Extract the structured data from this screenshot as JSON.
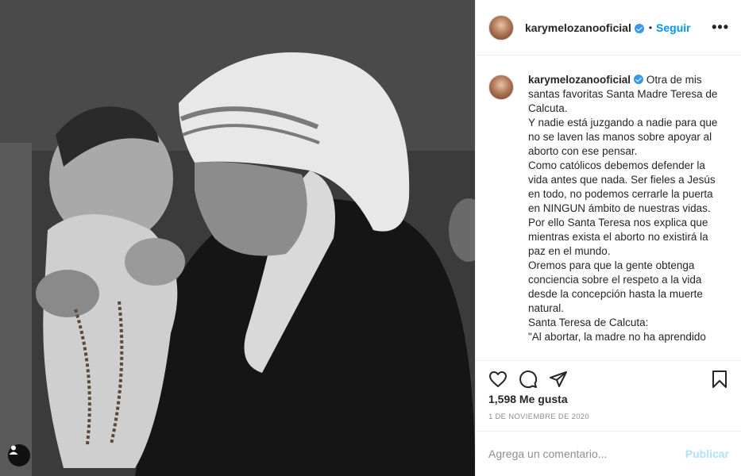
{
  "post": {
    "image_alt": "Santa Madre Teresa de Calcuta con un bebé"
  },
  "header": {
    "username": "karymelozanooficial",
    "separator": "•",
    "follow_label": "Seguir",
    "more_label": "•••"
  },
  "caption": {
    "username": "karymelozanooficial",
    "paragraphs": [
      "Otra de mis santas favoritas Santa Madre Teresa de Calcuta.",
      "Y nadie está juzgando a nadie para que no se laven las manos sobre apoyar al aborto con ese pensar.",
      "Como católicos debemos defender la vida antes que nada. Ser fieles a Jesús en todo, no podemos cerrarle la puerta en NINGUN ámbito de nuestras vidas.",
      "Por ello Santa Teresa nos explica que mientras exista el aborto no existirá la paz en el mundo.",
      "Oremos para que la gente obtenga conciencia sobre el respeto a la vida desde la concepción hasta la muerte natural.",
      "Santa Teresa de Calcuta:",
      "\"Al abortar, la madre no ha aprendido"
    ]
  },
  "actions": {
    "like_icon": "heart-icon",
    "comment_icon": "comment-icon",
    "share_icon": "send-icon",
    "save_icon": "bookmark-icon"
  },
  "likes_text": "1,598 Me gusta",
  "date_text": "1 DE NOVIEMBRE DE 2020",
  "comment": {
    "placeholder": "Agrega un comentario...",
    "publish_label": "Publicar"
  },
  "colors": {
    "accent": "#0095f6",
    "verified": "#3897f0",
    "publish_disabled": "#b2dffc",
    "border": "#efefef"
  }
}
